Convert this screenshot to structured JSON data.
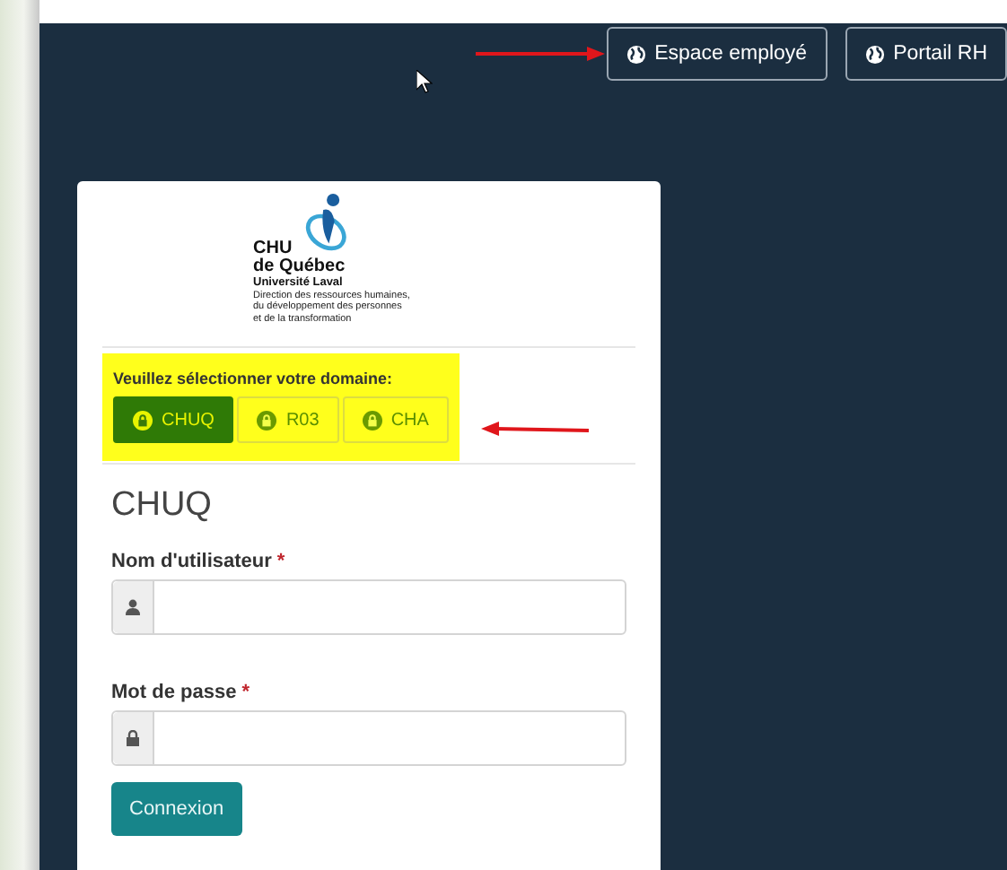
{
  "header": {
    "annotated": true,
    "buttons": [
      {
        "label": "Espace employé"
      },
      {
        "label": "Portail RH"
      }
    ]
  },
  "logo": {
    "name": "CHU",
    "city": "de Québec",
    "university": "Université Laval",
    "lines": [
      "Direction des ressources humaines,",
      "du développement des personnes",
      "et de la transformation"
    ]
  },
  "domain": {
    "prompt": "Veuillez sélectionner votre domaine:",
    "highlighted": true,
    "annotated": true,
    "options": [
      {
        "label": "CHUQ",
        "selected": true
      },
      {
        "label": "R03",
        "selected": false
      },
      {
        "label": "CHA",
        "selected": false
      }
    ]
  },
  "form": {
    "title": "CHUQ",
    "fields": [
      {
        "label": "Nom d'utilisateur",
        "required_mark": "*",
        "kind": "user"
      },
      {
        "label": "Mot de passe",
        "required_mark": "*",
        "kind": "password"
      }
    ],
    "submit": "Connexion"
  }
}
